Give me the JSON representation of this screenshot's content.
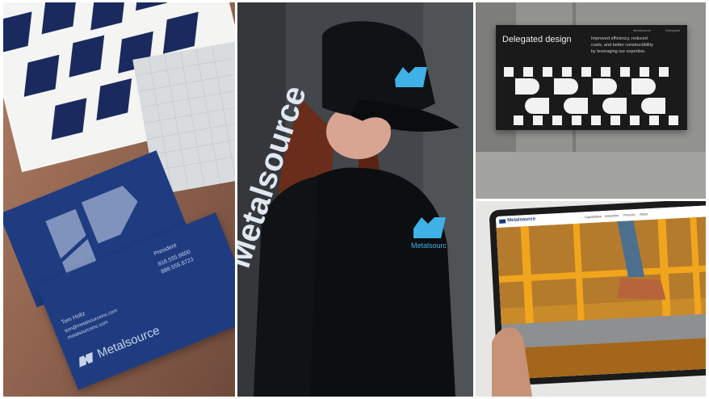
{
  "brand": {
    "name": "Metalsource",
    "logo_short": "Metalsourc",
    "sleeve_text": "Metalsource",
    "accent_color": "#29a8e0",
    "navy_color": "#1c3a7a"
  },
  "business_card": {
    "name": "Tom Holtz",
    "title": "President",
    "email": "tom@metalsourceinc.com",
    "website": "metalsourceinc.com",
    "phone_1": "816.555.6600",
    "phone_2": "888.555.8723"
  },
  "sign": {
    "title": "Delegated design",
    "body_line_1": "Improved efficiency, reduced",
    "body_line_2": "costs, and better constructibility",
    "body_line_3": "by leveraging our expertise.",
    "meta_left": "Metalsource",
    "meta_right": "Delegated"
  },
  "tablet": {
    "site_logo": "Metalsource",
    "nav": [
      "Capabilities",
      "Industries",
      "Process",
      "About"
    ]
  }
}
